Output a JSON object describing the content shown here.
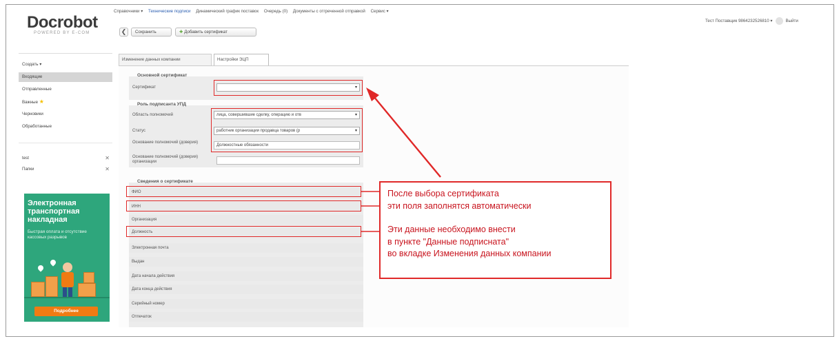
{
  "brand": {
    "logo": "Docrobot",
    "tagline": "POWERED BY E-COM"
  },
  "top_menu": {
    "items": [
      "Справочники ▾",
      "Технические подписи",
      "Динамический график поставок",
      "Очередь (0)",
      "Документы с отгреченной отправкой",
      "Сервис ▾"
    ],
    "user": "Тест Поставщик 9864232526810 ▾",
    "exit": "Выйти"
  },
  "toolbar": {
    "back": "❮",
    "save": "Сохранить",
    "add_certificate": "Добавить сертификат"
  },
  "sidebar": {
    "items": [
      "Создать ▾",
      "Входящие",
      "Отправленные",
      "Важные",
      "Черновики",
      "Обработанные"
    ],
    "folders": [
      "test",
      "Папки"
    ]
  },
  "banner": {
    "title": "Электронная транспортная накладная",
    "subtitle": "Быстрая оплата и отсутствие кассовых разрывов",
    "button": "Подробнее"
  },
  "tabs": [
    "Изменение данных компании",
    "Настройки ЭЦП"
  ],
  "form": {
    "main_cert": {
      "legend": "Основной сертификат",
      "label": "Сертификат",
      "value": ""
    },
    "signer_role": {
      "legend": "Роль подписанта УПД",
      "area_label": "Область полномочий",
      "area_value": "лица, совершившие сделку, операцию и отв",
      "status_label": "Статус",
      "status_value": "работник организации продавца товаров (р",
      "basis_label": "Основание полномочий (доверия)",
      "basis_value": "Должностные обязанности",
      "org_basis_label": "Основание полномочий (доверия) организации",
      "org_basis_value": ""
    },
    "cert_info": {
      "legend": "Сведения о сертификате",
      "fields": [
        "ФИО",
        "ИНН",
        "Организация",
        "Должность",
        "Электронная почта",
        "Выдан",
        "Дата начала действия",
        "Дата конца действия",
        "Серийный номер",
        "Отпечаток"
      ]
    }
  },
  "annotation": {
    "line1": "После выбора сертификата",
    "line2": "эти поля заполнятся автоматически",
    "line3": "Эти данные необходимо внести",
    "line4": "в пункте \"Данные подписната\"",
    "line5": "во  вкладке Изменения данных компании"
  },
  "colors": {
    "annotation_red": "#e02828",
    "banner_green": "#2ea67c",
    "banner_button": "#f07b13"
  }
}
